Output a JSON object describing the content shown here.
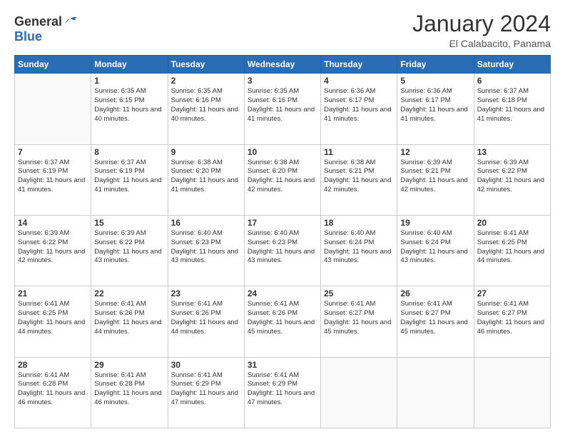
{
  "logo": {
    "general": "General",
    "blue": "Blue"
  },
  "header": {
    "month": "January 2024",
    "location": "El Calabacito, Panama"
  },
  "weekdays": [
    "Sunday",
    "Monday",
    "Tuesday",
    "Wednesday",
    "Thursday",
    "Friday",
    "Saturday"
  ],
  "weeks": [
    [
      {
        "day": "",
        "empty": true
      },
      {
        "day": "1",
        "sunrise": "6:35 AM",
        "sunset": "6:15 PM",
        "daylight": "11 hours and 40 minutes."
      },
      {
        "day": "2",
        "sunrise": "6:35 AM",
        "sunset": "6:16 PM",
        "daylight": "11 hours and 40 minutes."
      },
      {
        "day": "3",
        "sunrise": "6:35 AM",
        "sunset": "6:16 PM",
        "daylight": "11 hours and 41 minutes."
      },
      {
        "day": "4",
        "sunrise": "6:36 AM",
        "sunset": "6:17 PM",
        "daylight": "11 hours and 41 minutes."
      },
      {
        "day": "5",
        "sunrise": "6:36 AM",
        "sunset": "6:17 PM",
        "daylight": "11 hours and 41 minutes."
      },
      {
        "day": "6",
        "sunrise": "6:37 AM",
        "sunset": "6:18 PM",
        "daylight": "11 hours and 41 minutes."
      }
    ],
    [
      {
        "day": "7",
        "sunrise": "6:37 AM",
        "sunset": "6:19 PM",
        "daylight": "11 hours and 41 minutes."
      },
      {
        "day": "8",
        "sunrise": "6:37 AM",
        "sunset": "6:19 PM",
        "daylight": "11 hours and 41 minutes."
      },
      {
        "day": "9",
        "sunrise": "6:38 AM",
        "sunset": "6:20 PM",
        "daylight": "11 hours and 41 minutes."
      },
      {
        "day": "10",
        "sunrise": "6:38 AM",
        "sunset": "6:20 PM",
        "daylight": "11 hours and 42 minutes."
      },
      {
        "day": "11",
        "sunrise": "6:38 AM",
        "sunset": "6:21 PM",
        "daylight": "11 hours and 42 minutes."
      },
      {
        "day": "12",
        "sunrise": "6:39 AM",
        "sunset": "6:21 PM",
        "daylight": "11 hours and 42 minutes."
      },
      {
        "day": "13",
        "sunrise": "6:39 AM",
        "sunset": "6:22 PM",
        "daylight": "11 hours and 42 minutes."
      }
    ],
    [
      {
        "day": "14",
        "sunrise": "6:39 AM",
        "sunset": "6:22 PM",
        "daylight": "11 hours and 42 minutes."
      },
      {
        "day": "15",
        "sunrise": "6:39 AM",
        "sunset": "6:22 PM",
        "daylight": "11 hours and 43 minutes."
      },
      {
        "day": "16",
        "sunrise": "6:40 AM",
        "sunset": "6:23 PM",
        "daylight": "11 hours and 43 minutes."
      },
      {
        "day": "17",
        "sunrise": "6:40 AM",
        "sunset": "6:23 PM",
        "daylight": "11 hours and 43 minutes."
      },
      {
        "day": "18",
        "sunrise": "6:40 AM",
        "sunset": "6:24 PM",
        "daylight": "11 hours and 43 minutes."
      },
      {
        "day": "19",
        "sunrise": "6:40 AM",
        "sunset": "6:24 PM",
        "daylight": "11 hours and 43 minutes."
      },
      {
        "day": "20",
        "sunrise": "6:41 AM",
        "sunset": "6:25 PM",
        "daylight": "11 hours and 44 minutes."
      }
    ],
    [
      {
        "day": "21",
        "sunrise": "6:41 AM",
        "sunset": "6:25 PM",
        "daylight": "11 hours and 44 minutes."
      },
      {
        "day": "22",
        "sunrise": "6:41 AM",
        "sunset": "6:26 PM",
        "daylight": "11 hours and 44 minutes."
      },
      {
        "day": "23",
        "sunrise": "6:41 AM",
        "sunset": "6:26 PM",
        "daylight": "11 hours and 44 minutes."
      },
      {
        "day": "24",
        "sunrise": "6:41 AM",
        "sunset": "6:26 PM",
        "daylight": "11 hours and 45 minutes."
      },
      {
        "day": "25",
        "sunrise": "6:41 AM",
        "sunset": "6:27 PM",
        "daylight": "11 hours and 45 minutes."
      },
      {
        "day": "26",
        "sunrise": "6:41 AM",
        "sunset": "6:27 PM",
        "daylight": "11 hours and 45 minutes."
      },
      {
        "day": "27",
        "sunrise": "6:41 AM",
        "sunset": "6:27 PM",
        "daylight": "11 hours and 46 minutes."
      }
    ],
    [
      {
        "day": "28",
        "sunrise": "6:41 AM",
        "sunset": "6:28 PM",
        "daylight": "11 hours and 46 minutes."
      },
      {
        "day": "29",
        "sunrise": "6:41 AM",
        "sunset": "6:28 PM",
        "daylight": "11 hours and 46 minutes."
      },
      {
        "day": "30",
        "sunrise": "6:41 AM",
        "sunset": "6:29 PM",
        "daylight": "11 hours and 47 minutes."
      },
      {
        "day": "31",
        "sunrise": "6:41 AM",
        "sunset": "6:29 PM",
        "daylight": "11 hours and 47 minutes."
      },
      {
        "day": "",
        "empty": true
      },
      {
        "day": "",
        "empty": true
      },
      {
        "day": "",
        "empty": true
      }
    ]
  ],
  "labels": {
    "sunrise_prefix": "Sunrise: ",
    "sunset_prefix": "Sunset: ",
    "daylight_prefix": "Daylight: "
  }
}
